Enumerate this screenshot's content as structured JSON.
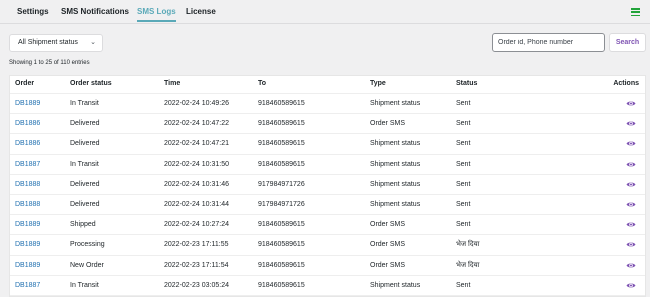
{
  "tabs": [
    {
      "label": "Settings",
      "active": false
    },
    {
      "label": "SMS Notifications",
      "active": false
    },
    {
      "label": "SMS Logs",
      "active": true
    },
    {
      "label": "License",
      "active": false
    }
  ],
  "filter": {
    "selected": "All Shipment status"
  },
  "search": {
    "placeholder": "Order id, Phone number",
    "button_label": "Search"
  },
  "showing_text": "Showing 1 to 25 of 110 entries",
  "columns": [
    "Order",
    "Order status",
    "Time",
    "To",
    "Type",
    "Status",
    "Actions"
  ],
  "rows": [
    {
      "order": "DB1889",
      "order_status": "In Transit",
      "time": "2022-02-24 10:49:26",
      "to": "918460589615",
      "type": "Shipment status",
      "status": "Sent"
    },
    {
      "order": "DB1886",
      "order_status": "Delivered",
      "time": "2022-02-24 10:47:22",
      "to": "918460589615",
      "type": "Order SMS",
      "status": "Sent"
    },
    {
      "order": "DB1886",
      "order_status": "Delivered",
      "time": "2022-02-24 10:47:21",
      "to": "918460589615",
      "type": "Shipment status",
      "status": "Sent"
    },
    {
      "order": "DB1887",
      "order_status": "In Transit",
      "time": "2022-02-24 10:31:50",
      "to": "918460589615",
      "type": "Shipment status",
      "status": "Sent"
    },
    {
      "order": "DB1888",
      "order_status": "Delivered",
      "time": "2022-02-24 10:31:46",
      "to": "917984971726",
      "type": "Shipment status",
      "status": "Sent"
    },
    {
      "order": "DB1888",
      "order_status": "Delivered",
      "time": "2022-02-24 10:31:44",
      "to": "917984971726",
      "type": "Shipment status",
      "status": "Sent"
    },
    {
      "order": "DB1889",
      "order_status": "Shipped",
      "time": "2022-02-24 10:27:24",
      "to": "918460589615",
      "type": "Order SMS",
      "status": "Sent"
    },
    {
      "order": "DB1889",
      "order_status": "Processing",
      "time": "2022-02-23 17:11:55",
      "to": "918460589615",
      "type": "Order SMS",
      "status": "भेज दिया"
    },
    {
      "order": "DB1889",
      "order_status": "New Order",
      "time": "2022-02-23 17:11:54",
      "to": "918460589615",
      "type": "Order SMS",
      "status": "भेज दिया"
    },
    {
      "order": "DB1887",
      "order_status": "In Transit",
      "time": "2022-02-23 03:05:24",
      "to": "918460589615",
      "type": "Shipment status",
      "status": "Sent"
    }
  ],
  "colors": {
    "accent": "#5aa9b8",
    "link": "#2271b1",
    "purple": "#7f54b3",
    "menu": "#22a33a"
  },
  "icons": {
    "row_action": "eye-icon",
    "menu": "hamburger-menu-icon",
    "select": "chevron-down-icon"
  }
}
